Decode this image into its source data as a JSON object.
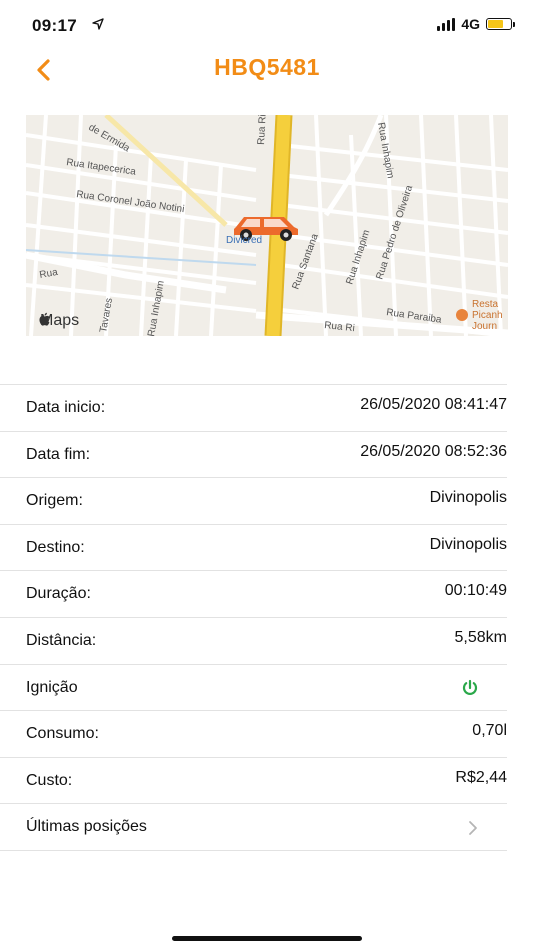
{
  "status_bar": {
    "time": "09:17",
    "network": "4G"
  },
  "header": {
    "title": "HBQ5481"
  },
  "map": {
    "attribution": "Maps",
    "streets": [
      "de Ermida",
      "Rua Itapecerica",
      "Rua Coronel João Notini",
      "Rua Ri",
      "Rua Inhapim",
      "Rua Santana",
      "Rua Inhapim",
      "Rua Pedro de Oliveira",
      "Rua Paraiba",
      "Rua Ri",
      "Tavares",
      "Rua",
      "Rua Inhapim"
    ],
    "marker_label": "Divicred",
    "poi_label": [
      "Resta",
      "Picanh",
      "Journ"
    ]
  },
  "details": [
    {
      "label": "Data inicio:",
      "value": "26/05/2020 08:41:47"
    },
    {
      "label": "Data fim:",
      "value": "26/05/2020 08:52:36"
    },
    {
      "label": "Origem:",
      "value": "Divinopolis"
    },
    {
      "label": "Destino:",
      "value": "Divinopolis"
    },
    {
      "label": "Duração:",
      "value": "00:10:49"
    },
    {
      "label": "Distância:",
      "value": "5,58km"
    },
    {
      "label": "Ignição",
      "icon": "power-icon"
    },
    {
      "label": "Consumo:",
      "value": "0,70l"
    },
    {
      "label": "Custo:",
      "value": "R$2,44"
    },
    {
      "label": "Últimas posições",
      "icon": "chevron-right-icon"
    }
  ],
  "colors": {
    "accent": "#f28c16",
    "ignition_on": "#2aa84a",
    "road_major": "#f5cf3c"
  }
}
